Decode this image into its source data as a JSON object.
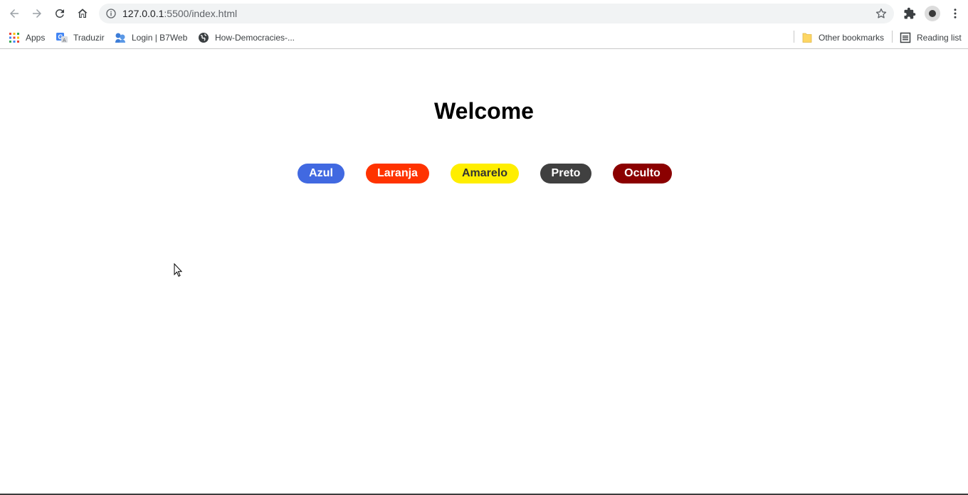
{
  "browser": {
    "url_host": "127.0.0.1",
    "url_path": ":5500/index.html",
    "icons": {
      "back": "back-arrow-icon",
      "forward": "forward-arrow-icon",
      "reload": "reload-icon",
      "home": "home-icon",
      "site_info": "info-icon",
      "bookmark_star": "star-icon",
      "extensions": "puzzle-icon",
      "profile": "avatar",
      "menu": "kebab-menu-icon"
    }
  },
  "bookmarks": {
    "items": [
      {
        "label": "Apps",
        "icon": "apps-grid-icon"
      },
      {
        "label": "Traduzir",
        "icon": "translate-icon"
      },
      {
        "label": "Login | B7Web",
        "icon": "b7web-icon"
      },
      {
        "label": "How-Democracies-...",
        "icon": "globe-icon"
      }
    ],
    "other_bookmarks": {
      "label": "Other bookmarks",
      "icon": "folder-icon"
    },
    "reading_list": {
      "label": "Reading list",
      "icon": "reading-list-icon"
    }
  },
  "page": {
    "title": "Welcome",
    "buttons": [
      {
        "label": "Azul",
        "bg": "#4169e1",
        "fg": "#ffffff"
      },
      {
        "label": "Laranja",
        "bg": "#ff3300",
        "fg": "#ffffff"
      },
      {
        "label": "Amarelo",
        "bg": "#ffee00",
        "fg": "#333333"
      },
      {
        "label": "Preto",
        "bg": "#404040",
        "fg": "#ffffff"
      },
      {
        "label": "Oculto",
        "bg": "#8b0000",
        "fg": "#ffffff"
      }
    ]
  }
}
